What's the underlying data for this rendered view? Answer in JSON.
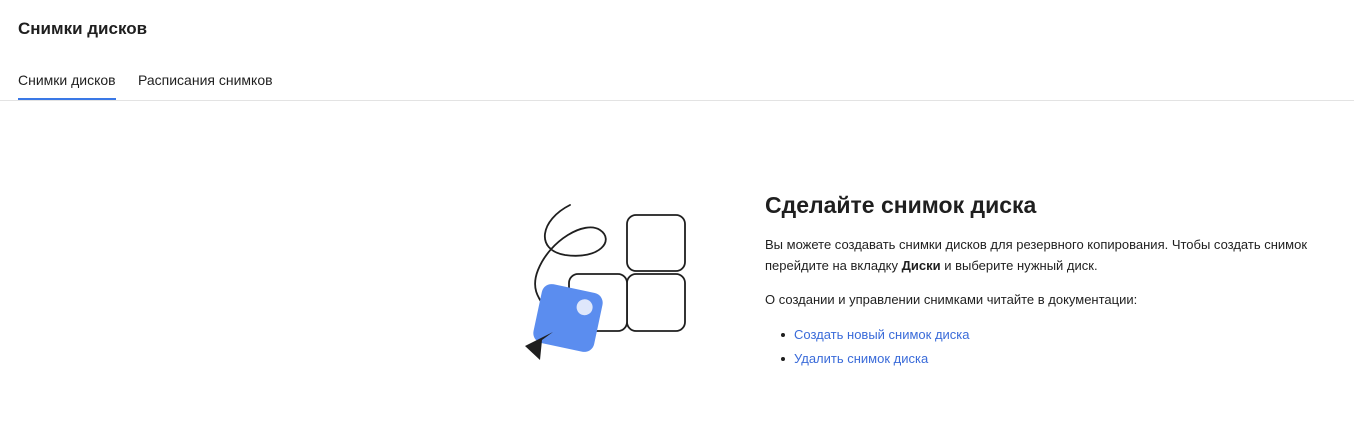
{
  "page": {
    "title": "Снимки дисков"
  },
  "tabs": [
    {
      "label": "Снимки дисков",
      "active": true
    },
    {
      "label": "Расписания снимков",
      "active": false
    }
  ],
  "empty_state": {
    "heading": "Сделайте снимок диска",
    "desc_part1": "Вы можете создавать снимки дисков для резервного копирования. Чтобы создать снимок перейдите на вкладку ",
    "desc_bold": "Диски",
    "desc_part2": " и выберите нужный диск.",
    "doc_text": "О создании и управлении снимками читайте в документации:",
    "links": [
      {
        "label": "Создать новый снимок диска"
      },
      {
        "label": "Удалить снимок диска"
      }
    ]
  },
  "colors": {
    "accent": "#3a78e6",
    "link": "#3a6bd9",
    "illustration_blue": "#5b8def"
  },
  "icons": {
    "illustration": "snapshot-grid-illustration",
    "cursor": "arrow-cursor-icon"
  }
}
